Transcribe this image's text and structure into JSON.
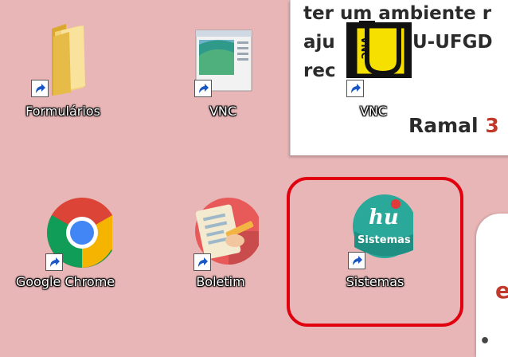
{
  "wallpaper": {
    "note_lines": [
      "ter um ambiente r",
      "aju",
      "U-UFGD",
      "rec"
    ],
    "ramal_label": "Ramal",
    "ramal_digit": "3",
    "side_letter": "e",
    "side_bullet": "•"
  },
  "desktop": {
    "icons": [
      {
        "label": "Formulários",
        "icon": "folder-icon"
      },
      {
        "label": "VNC",
        "icon": "vnc-window-icon"
      },
      {
        "label": "VNC",
        "icon": "vnc-logo-icon"
      },
      {
        "label": "Google Chrome",
        "icon": "chrome-icon"
      },
      {
        "label": "Boletim",
        "icon": "boletim-icon"
      },
      {
        "label": "Sistemas",
        "icon": "hu-sistemas-icon"
      }
    ],
    "vnc_logo_text": "VNC",
    "sistemas_logo_top": "hu",
    "sistemas_logo_bottom": "Sistemas"
  },
  "colors": {
    "wallpaper": "#e8b6b7",
    "highlight": "#e10010",
    "sistemas_teal": "#2aa89a"
  }
}
